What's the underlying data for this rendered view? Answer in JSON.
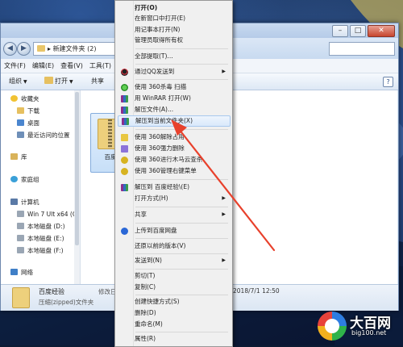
{
  "window": {
    "address": "新建文件夹 (2)",
    "menubar": [
      "文件(F)",
      "编辑(E)",
      "查看(V)",
      "工具(T)"
    ],
    "toolbar": {
      "organize": "组织",
      "open": "打开",
      "share": "共享"
    }
  },
  "sidebar": {
    "items": [
      {
        "label": "收藏夹",
        "icon": "star-icon"
      },
      {
        "label": "下载",
        "icon": "download-folder-icon"
      },
      {
        "label": "桌面",
        "icon": "desktop-icon"
      },
      {
        "label": "最近访问的位置",
        "icon": "recent-places-icon"
      },
      {
        "label": "库",
        "icon": "library-icon"
      },
      {
        "label": "家庭组",
        "icon": "homegroup-icon"
      },
      {
        "label": "计算机",
        "icon": "computer-icon"
      },
      {
        "label": "Win 7 Ult x64 (C",
        "icon": "drive-icon"
      },
      {
        "label": "本地磁盘 (D:)",
        "icon": "drive-icon"
      },
      {
        "label": "本地磁盘 (E:)",
        "icon": "drive-icon"
      },
      {
        "label": "本地磁盘 (F:)",
        "icon": "drive-icon"
      },
      {
        "label": "网络",
        "icon": "network-icon"
      }
    ]
  },
  "content": {
    "file_label": "百度"
  },
  "details": {
    "name": "百度经验",
    "type": "压缩(zipped)文件夹",
    "modified_label": "修改日",
    "modified_value": "2018/7/1 12:50"
  },
  "context_menu": {
    "items": [
      {
        "label": "打开(O)",
        "bold": true
      },
      {
        "label": "在新窗口中打开(E)"
      },
      {
        "label": "用记事本打开(N)"
      },
      {
        "label": "管理员取得所有权"
      },
      {
        "label": "全部提取(T)..."
      },
      {
        "label": "通过QQ发送到",
        "submenu": true,
        "icon": "qq-icon"
      },
      {
        "label": "使用 360杀毒 扫描",
        "icon": "360-antivirus-icon"
      },
      {
        "label": "用 WinRAR 打开(W)",
        "icon": "winrar-icon"
      },
      {
        "label": "解压文件(A)...",
        "icon": "winrar-icon"
      },
      {
        "label": "解压到当前文件夹(X)",
        "icon": "winrar-icon",
        "highlighted": true
      },
      {
        "label": "使用 360解除占用",
        "icon": "360-unlock-icon"
      },
      {
        "label": "使用 360强力删除",
        "icon": "360-delete-icon"
      },
      {
        "label": "使用 360进行木马云查杀",
        "icon": "360-trojan-icon"
      },
      {
        "label": "使用 360管理右键菜单",
        "icon": "360-menu-icon"
      },
      {
        "label": "解压到 百度经验\\(E)",
        "icon": "winrar-icon"
      },
      {
        "label": "打开方式(H)",
        "submenu": true
      },
      {
        "label": "共享",
        "submenu": true
      },
      {
        "label": "上传到百度网盘",
        "icon": "baidu-netdisk-icon"
      },
      {
        "label": "还原以前的版本(V)"
      },
      {
        "label": "发送到(N)",
        "submenu": true
      },
      {
        "label": "剪切(T)"
      },
      {
        "label": "复制(C)"
      },
      {
        "label": "创建快捷方式(S)"
      },
      {
        "label": "删除(D)"
      },
      {
        "label": "重命名(M)"
      },
      {
        "label": "属性(R)"
      }
    ]
  },
  "watermark": {
    "title": "大百网",
    "url": "big100.net"
  },
  "colors": {
    "highlight": "#d9e9fb",
    "arrow": "#e8412c"
  }
}
